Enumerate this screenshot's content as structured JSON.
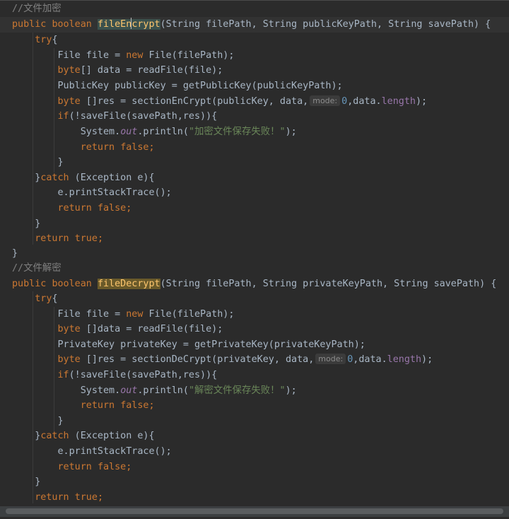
{
  "editor": {
    "inlay_hint_label": "mode:",
    "encrypt": {
      "comment": "//文件加密",
      "sig_kw1": "public",
      "sig_kw2": "boolean",
      "method_name_a": "fileEn",
      "method_name_b": "crypt",
      "params": "(String filePath, String publicKeyPath, String savePath) {",
      "try_kw": "try",
      "try_open": "{",
      "l1_type": "File file = ",
      "l1_new": "new",
      "l1_rest": " File(filePath);",
      "l2_kw": "byte",
      "l2_rest": "[] data = readFile(file);",
      "l3": "PublicKey publicKey = getPublicKey(publicKeyPath);",
      "l4_kw": "byte",
      "l4_rest": " []res = sectionEnCrypt(publicKey, data,",
      "l4_num": "0",
      "l4_mid": ",data.",
      "l4_field": "length",
      "l4_end": ");",
      "l5_kw": "if",
      "l5_rest": "(!saveFile(savePath,res)){",
      "l6_a": "System.",
      "l6_out": "out",
      "l6_b": ".println(",
      "l6_str": "\"加密文件保存失败！\"",
      "l6_end": ");",
      "l7_kw": "return",
      "l7_false": "false",
      "l7_end": ";",
      "close_inner": "}",
      "catch_open": "}",
      "catch_kw": "catch",
      "catch_rest": " (Exception e){",
      "l8": "e.printStackTrace();",
      "l9_kw": "return",
      "l9_false": "false",
      "l9_end": ";",
      "close_catch": "}",
      "l10_kw": "return",
      "l10_true": "true",
      "l10_end": ";",
      "close_method": "}"
    },
    "decrypt": {
      "comment": "//文件解密",
      "sig_kw1": "public",
      "sig_kw2": "boolean",
      "method_name": "fileDecrypt",
      "params": "(String filePath, String privateKeyPath, String savePath) {",
      "try_kw": "try",
      "try_open": "{",
      "l1_type": "File file = ",
      "l1_new": "new",
      "l1_rest": " File(filePath);",
      "l2_kw": "byte",
      "l2_rest": " []data = readFile(file);",
      "l3": "PrivateKey privateKey = getPrivateKey(privateKeyPath);",
      "l4_kw": "byte",
      "l4_rest": " []res = sectionDeCrypt(privateKey, data,",
      "l4_num": "0",
      "l4_mid": ",data.",
      "l4_field": "length",
      "l4_end": ");",
      "l5_kw": "if",
      "l5_rest": "(!saveFile(savePath,res)){",
      "l6_a": "System.",
      "l6_out": "out",
      "l6_b": ".println(",
      "l6_str": "\"解密文件保存失败！\"",
      "l6_end": ");",
      "l7_kw": "return",
      "l7_false": "false",
      "l7_end": ";",
      "close_inner": "}",
      "catch_open": "}",
      "catch_kw": "catch",
      "catch_rest": " (Exception e){",
      "l8": "e.printStackTrace();",
      "l9_kw": "return",
      "l9_false": "false",
      "l9_end": ";",
      "close_catch": "}",
      "l10_kw": "return",
      "l10_true": "true",
      "l10_end": ";",
      "close_method": "}"
    }
  }
}
